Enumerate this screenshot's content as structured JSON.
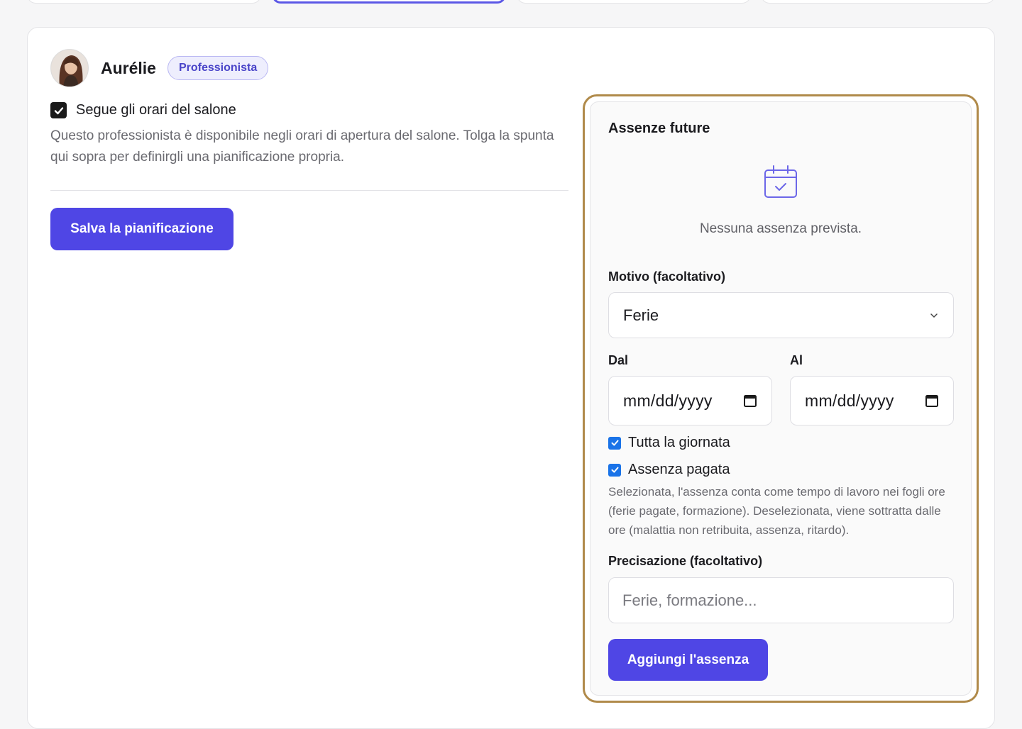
{
  "colors": {
    "accent": "#4f46e5",
    "panel_border": "#b08a4a",
    "badge_bg": "#eeeefd",
    "badge_text": "#4a45c9",
    "checkbox_blue": "#1a73e8"
  },
  "staff": {
    "name": "Aurélie",
    "role": "Professionista",
    "avatar_icon": "avatar-photo"
  },
  "schedule": {
    "follows_salon_hours": true,
    "follow_label": "Segue gli orari del salone",
    "follow_help": "Questo professionista è disponibile negli orari di apertura del salone. Tolga la spunta qui sopra per definirgli una pianificazione propria.",
    "save_label": "Salva la pianificazione"
  },
  "absences": {
    "title": "Assenze future",
    "empty_icon": "calendar-check-icon",
    "empty_text": "Nessuna assenza prevista.",
    "reason_label": "Motivo (facoltativo)",
    "reason_value": "Ferie",
    "from_label": "Dal",
    "to_label": "Al",
    "from_placeholder": "mm/dd/yyyy",
    "to_placeholder": "mm/dd/yyyy",
    "all_day_label": "Tutta la giornata",
    "all_day_checked": true,
    "paid_label": "Assenza pagata",
    "paid_checked": true,
    "paid_help": "Selezionata, l'assenza conta come tempo di lavoro nei fogli ore (ferie pagate, formazione). Deselezionata, viene sottratta dalle ore (malattia non retribuita, assenza, ritardo).",
    "note_label": "Precisazione (facoltativo)",
    "note_placeholder": "Ferie, formazione...",
    "add_label": "Aggiungi l'assenza"
  }
}
